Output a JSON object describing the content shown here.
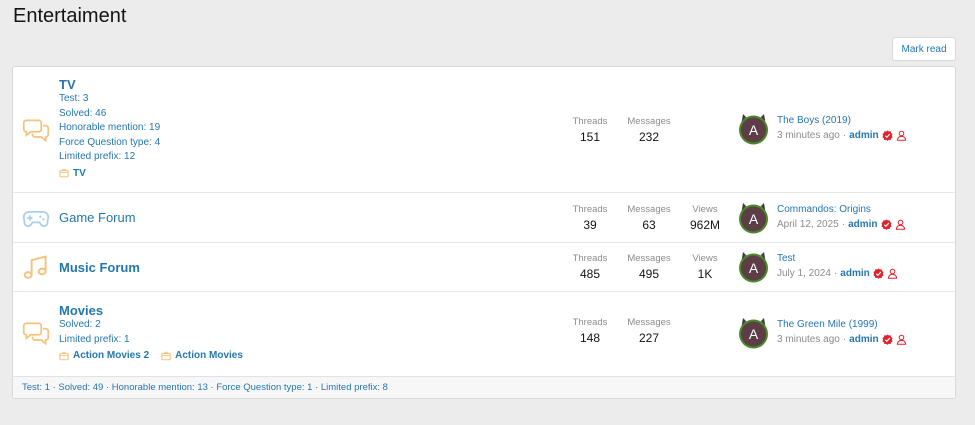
{
  "page": {
    "title": "Entertaiment",
    "mark_read": "Mark read"
  },
  "colors": {
    "link": "#2577b1",
    "icon_orange": "#f4c27a",
    "icon_blue": "#a9cfee",
    "badge_red": "#e0232b"
  },
  "forums": [
    {
      "title": "TV",
      "meta": [
        "Test: 3",
        "Solved: 46",
        "Honorable mention: 19",
        "Force Question type: 4",
        "Limited prefix: 12"
      ],
      "subforums": [
        "TV"
      ],
      "stats": {
        "threads_label": "Threads",
        "threads": "151",
        "messages_label": "Messages",
        "messages": "232"
      },
      "last_post": {
        "title": "The Boys (2019)",
        "time": "3 minutes ago",
        "user": "admin",
        "avatar_letter": "A"
      }
    },
    {
      "title": "Game Forum",
      "stats": {
        "threads_label": "Threads",
        "threads": "39",
        "messages_label": "Messages",
        "messages": "63",
        "views_label": "Views",
        "views": "962M"
      },
      "last_post": {
        "title": "Commandos: Origins",
        "time": "April 12, 2025",
        "user": "admin",
        "avatar_letter": "A"
      }
    },
    {
      "title": "Music Forum",
      "stats": {
        "threads_label": "Threads",
        "threads": "485",
        "messages_label": "Messages",
        "messages": "495",
        "views_label": "Views",
        "views": "1K"
      },
      "last_post": {
        "title": "Test",
        "time": "July 1, 2024",
        "user": "admin",
        "avatar_letter": "A"
      }
    },
    {
      "title": "Movies",
      "meta": [
        "Solved: 2",
        "Limited prefix: 1"
      ],
      "subforums": [
        "Action Movies 2",
        "Action Movies"
      ],
      "stats": {
        "threads_label": "Threads",
        "threads": "148",
        "messages_label": "Messages",
        "messages": "227"
      },
      "last_post": {
        "title": "The Green Mile (1999)",
        "time": "3 minutes ago",
        "user": "admin",
        "avatar_letter": "A"
      }
    }
  ],
  "footer": "Test: 1 · Solved: 49 · Honorable mention: 13 · Force Question type: 1 · Limited prefix: 8"
}
